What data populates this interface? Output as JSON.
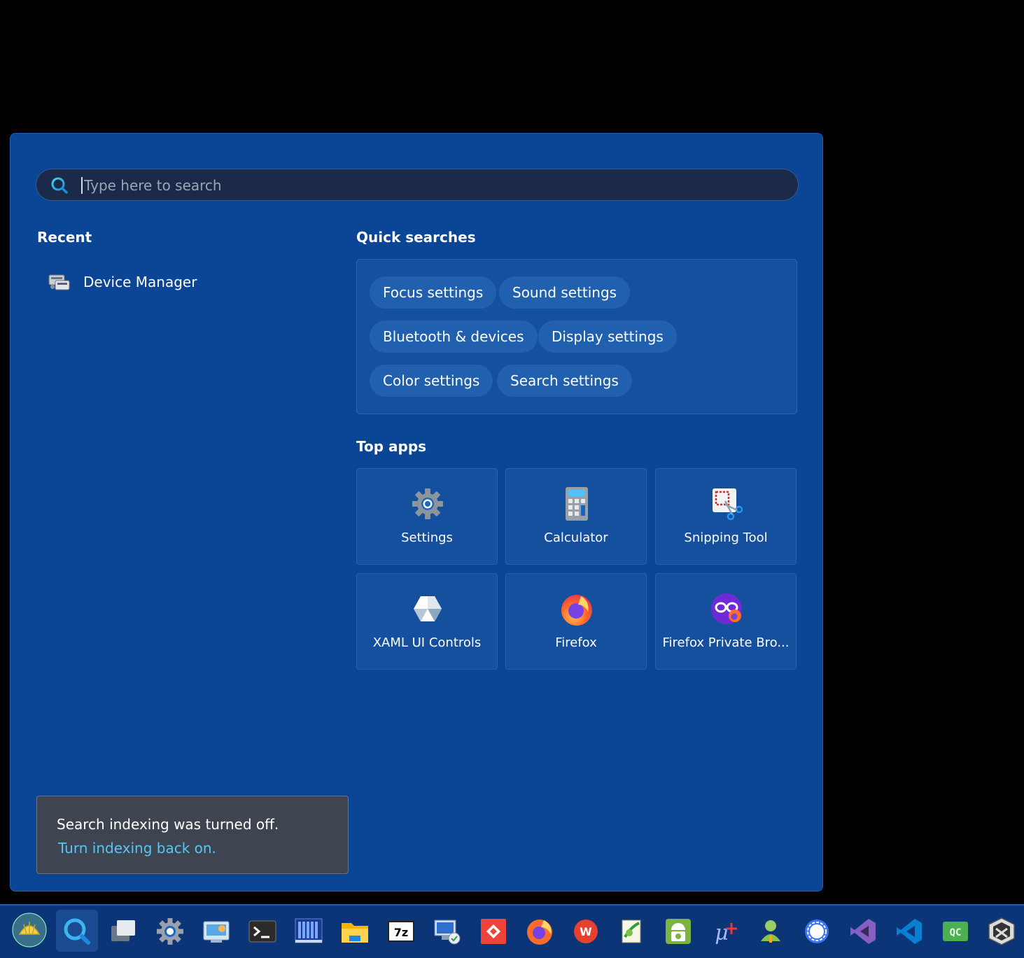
{
  "search": {
    "placeholder": "Type here to search"
  },
  "recent": {
    "title": "Recent",
    "items": [
      {
        "label": "Device Manager",
        "icon": "device-manager-icon"
      }
    ]
  },
  "quick_searches": {
    "title": "Quick searches",
    "items": [
      {
        "label": "Focus settings"
      },
      {
        "label": "Sound settings"
      },
      {
        "label": "Bluetooth & devices"
      },
      {
        "label": "Display settings"
      },
      {
        "label": "Color settings"
      },
      {
        "label": "Search settings"
      }
    ]
  },
  "top_apps": {
    "title": "Top apps",
    "items": [
      {
        "label": "Settings",
        "icon": "settings-gear-icon"
      },
      {
        "label": "Calculator",
        "icon": "calculator-icon"
      },
      {
        "label": "Snipping Tool",
        "icon": "snipping-tool-icon"
      },
      {
        "label": "XAML UI Controls",
        "icon": "xaml-controls-icon"
      },
      {
        "label": "Firefox",
        "icon": "firefox-icon"
      },
      {
        "label": "Firefox Private Bro...",
        "icon": "firefox-private-icon"
      }
    ]
  },
  "toast": {
    "message": "Search indexing was turned off.",
    "link": "Turn indexing back on."
  },
  "colors": {
    "panel": "#0a4596",
    "link": "#58c6f4",
    "taskbar": "#0c3577"
  },
  "taskbar": {
    "icons": [
      "shell-logo-icon",
      "search-icon",
      "task-view-icon",
      "settings-gear-icon",
      "control-panel-icon",
      "terminal-icon",
      "server-app-icon",
      "file-explorer-icon",
      "7zip-icon",
      "remote-desktop-icon",
      "anydesk-icon",
      "firefox-icon",
      "wps-office-icon",
      "notepad-plus-icon",
      "android-icon",
      "uvision-icon",
      "user-app-icon",
      "signal-icon",
      "visual-studio-icon",
      "vscode-icon",
      "qc-app-icon",
      "mplab-x-ide-icon"
    ]
  }
}
